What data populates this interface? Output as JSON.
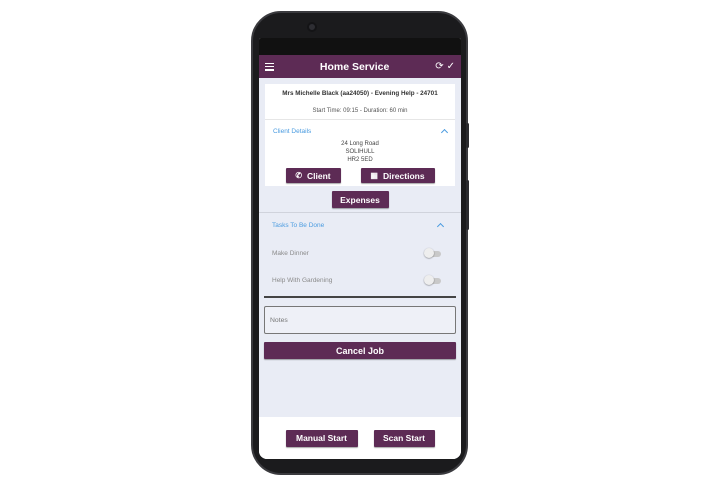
{
  "app": {
    "title": "Home Service"
  },
  "icons": {
    "menu": "hamburger-menu-icon",
    "sync": "sync-icon",
    "check": "check-icon",
    "phone": "phone-icon",
    "map": "map-icon"
  },
  "colors": {
    "primary": "#5d2b55",
    "link": "#4a9be0",
    "background": "#e9ecf5"
  },
  "job": {
    "title": "Mrs Michelle Black (aa24050) - Evening Help - 24701",
    "time": "Start Time: 09:15 - Duration: 60 min"
  },
  "client_details": {
    "header": "Client Details",
    "address": [
      "24 Long Road",
      "SOLIHULL",
      "HR2 5ED"
    ],
    "client_button": "Client",
    "directions_button": "Directions"
  },
  "expenses_button": "Expenses",
  "tasks": {
    "header": "Tasks To Be Done",
    "items": [
      {
        "label": "Make Dinner",
        "done": false
      },
      {
        "label": "Help With Gardening",
        "done": false
      }
    ]
  },
  "notes": {
    "placeholder": "Notes"
  },
  "cancel_button": "Cancel Job",
  "footer": {
    "manual_start": "Manual Start",
    "scan_start": "Scan Start"
  }
}
